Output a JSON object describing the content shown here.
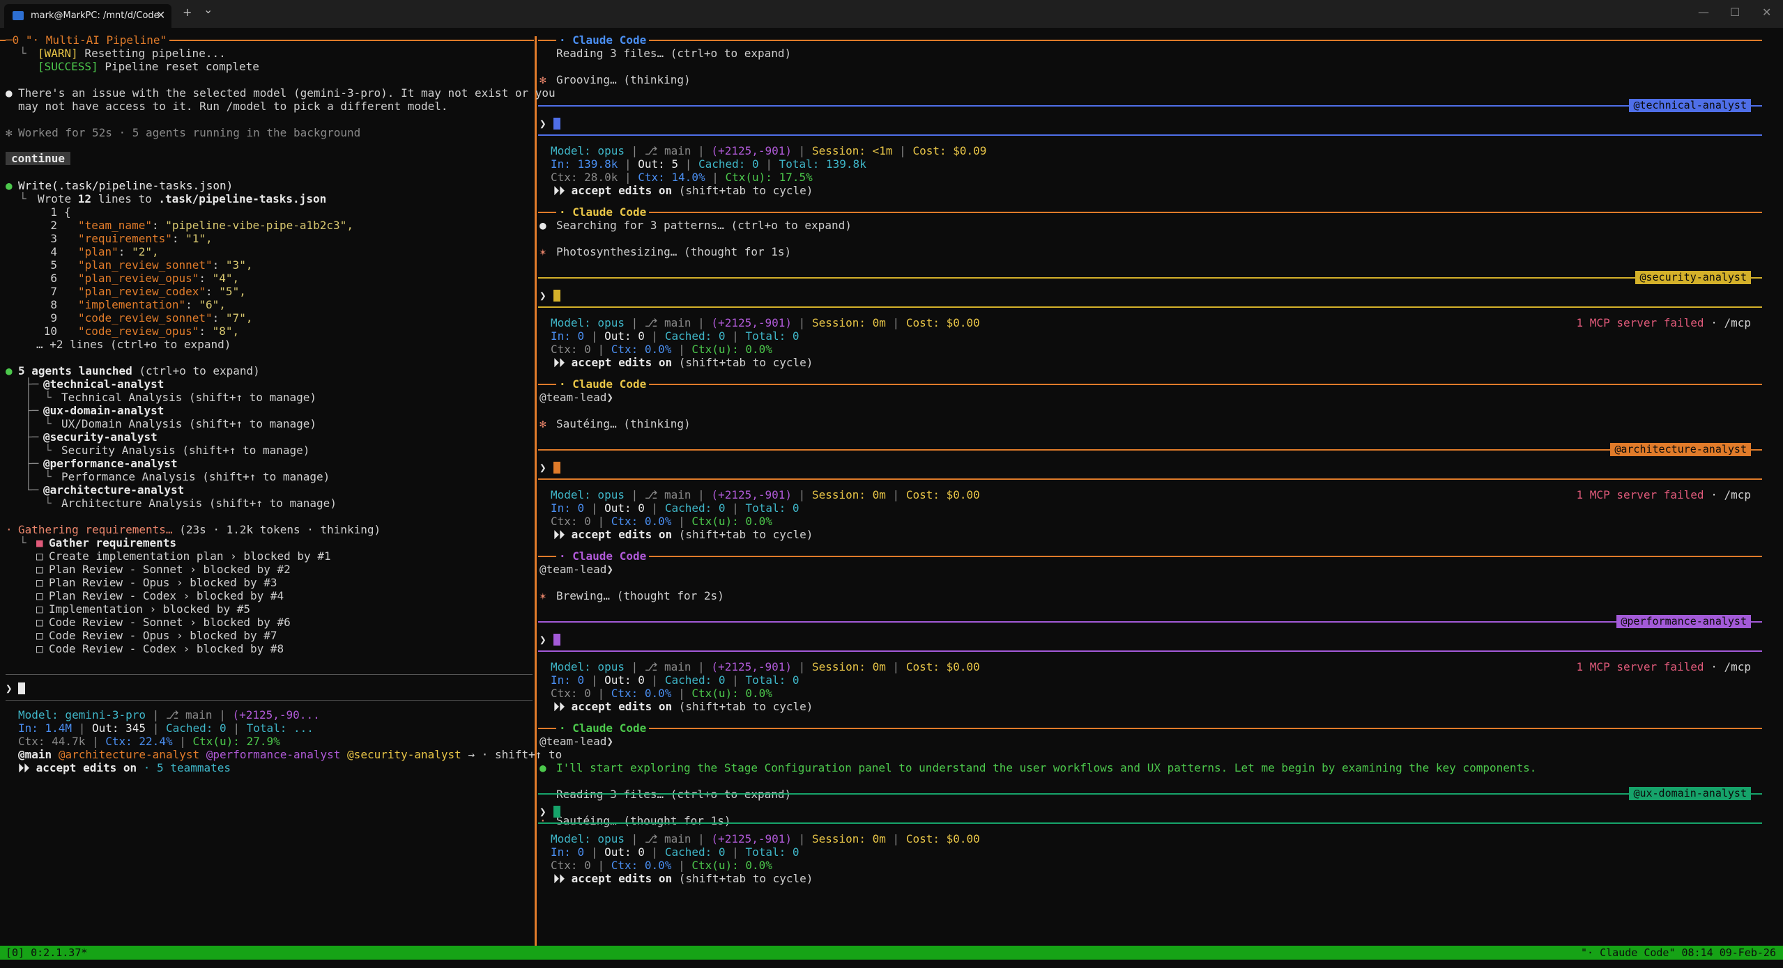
{
  "window": {
    "tab_title": "mark@MarkPC: /mnt/d/Code",
    "new_tab": "+",
    "dropdown": "⌄",
    "minimize": "—",
    "maximize": "☐",
    "close": "✕"
  },
  "left": {
    "header": "─0 \"· Multi-AI Pipeline\"",
    "warn_tag": "[WARN]",
    "warn_text": " Resetting pipeline...",
    "success_tag": "[SUCCESS]",
    "success_text": " Pipeline reset complete",
    "model_issue_1": "There's an issue with the selected model (gemini-3-pro). It may not exist or you",
    "model_issue_2": "may not have access to it. Run /model to pick a different model.",
    "worked": "Worked for 52s · 5 agents running in the background",
    "continue": "continue",
    "write_cmd": "Write(.task/pipeline-tasks.json)",
    "wrote_prefix": "Wrote ",
    "wrote_count": "12",
    "wrote_mid": " lines to ",
    "wrote_file": ".task/pipeline-tasks.json",
    "code_lines": [
      {
        "n": "1",
        "k": "",
        "v": "{"
      },
      {
        "n": "2",
        "k": "\"team_name\"",
        "v": "\"pipeline-vibe-pipe-a1b2c3\","
      },
      {
        "n": "3",
        "k": "\"requirements\"",
        "v": "\"1\","
      },
      {
        "n": "4",
        "k": "\"plan\"",
        "v": "\"2\","
      },
      {
        "n": "5",
        "k": "\"plan_review_sonnet\"",
        "v": "\"3\","
      },
      {
        "n": "6",
        "k": "\"plan_review_opus\"",
        "v": "\"4\","
      },
      {
        "n": "7",
        "k": "\"plan_review_codex\"",
        "v": "\"5\","
      },
      {
        "n": "8",
        "k": "\"implementation\"",
        "v": "\"6\","
      },
      {
        "n": "9",
        "k": "\"code_review_sonnet\"",
        "v": "\"7\","
      },
      {
        "n": "10",
        "k": "\"code_review_opus\"",
        "v": "\"8\","
      }
    ],
    "more_lines": "… +2 lines (ctrl+o to expand)",
    "agents_launched": "5 agents launched",
    "agents_expand": " (ctrl+o to expand)",
    "agents": [
      {
        "name": "@technical-analyst",
        "desc": "Technical Analysis (shift+↑ to manage)"
      },
      {
        "name": "@ux-domain-analyst",
        "desc": "UX/Domain Analysis (shift+↑ to manage)"
      },
      {
        "name": "@security-analyst",
        "desc": "Security Analysis (shift+↑ to manage)"
      },
      {
        "name": "@performance-analyst",
        "desc": "Performance Analysis (shift+↑ to manage)"
      },
      {
        "name": "@architecture-analyst",
        "desc": "Architecture Analysis (shift+↑ to manage)"
      }
    ],
    "gathering": "Gathering requirements…",
    "gathering_meta": " (23s · 1.2k tokens · thinking)",
    "tasks_head": "Gather requirements",
    "tasks": [
      "Create implementation plan › blocked by #1",
      "Plan Review - Sonnet › blocked by #2",
      "Plan Review - Opus › blocked by #3",
      "Plan Review - Codex › blocked by #4",
      "Implementation › blocked by #5",
      "Code Review - Sonnet › blocked by #6",
      "Code Review - Opus › blocked by #7",
      "Code Review - Codex › blocked by #8"
    ],
    "prompt": "❯",
    "status_model": "Model: gemini-3-pro",
    "status_branch": "⎇ main",
    "status_diff": "(+2125,-90...",
    "in": "In: 1.4M",
    "out": "Out: 345",
    "cached": "Cached: 0",
    "total": "Total: ...",
    "ctx": "Ctx: 44.7k",
    "ctxp": "Ctx: 22.4%",
    "ctxu": "Ctx(u): 27.9%",
    "team_main": "@main",
    "team_arch": "@architecture-analyst",
    "team_perf": "@performance-analyst",
    "team_sec": "@security-analyst",
    "team_tail": " → · shift+↑ to",
    "accept": "⏵⏵ accept edits on",
    "teammates": " · 5 teammates"
  },
  "panes": [
    {
      "title": "· Claude Code",
      "line1": "Reading 3 files… (ctrl+o to expand)",
      "line2": "Grooving… (thinking)",
      "tag": "@technical-analyst",
      "model": "Model: opus",
      "session": "Session: <1m",
      "cost": "Cost: $0.09",
      "in": "In: 139.8k",
      "out": "Out: 5",
      "cached": "Cached: 0",
      "total": "Total: 139.8k",
      "ctx": "Ctx: 28.0k",
      "ctxp": "Ctx: 14.0%",
      "ctxu": "Ctx(u): 17.5%",
      "mcp": ""
    },
    {
      "title": "· Claude Code",
      "line1": "Searching for 3 patterns… (ctrl+o to expand)",
      "line2": "Photosynthesizing… (thought for 1s)",
      "tag": "@security-analyst",
      "model": "Model: opus",
      "session": "Session: 0m",
      "cost": "Cost: $0.00",
      "in": "In: 0",
      "out": "Out: 0",
      "cached": "Cached: 0",
      "total": "Total: 0",
      "ctx": "Ctx: 0",
      "ctxp": "Ctx: 0.0%",
      "ctxu": "Ctx(u): 0.0%",
      "mcp": "1 MCP server failed"
    },
    {
      "title": "· Claude Code",
      "line1": "@team-lead❯",
      "line2": "Sautéing… (thinking)",
      "tag": "@architecture-analyst",
      "model": "Model: opus",
      "session": "Session: 0m",
      "cost": "Cost: $0.00",
      "in": "In: 0",
      "out": "Out: 0",
      "cached": "Cached: 0",
      "total": "Total: 0",
      "ctx": "Ctx: 0",
      "ctxp": "Ctx: 0.0%",
      "ctxu": "Ctx(u): 0.0%",
      "mcp": "1 MCP server failed"
    },
    {
      "title": "· Claude Code",
      "line1": "@team-lead❯",
      "line2": "Brewing… (thought for 2s)",
      "tag": "@performance-analyst",
      "model": "Model: opus",
      "session": "Session: 0m",
      "cost": "Cost: $0.00",
      "in": "In: 0",
      "out": "Out: 0",
      "cached": "Cached: 0",
      "total": "Total: 0",
      "ctx": "Ctx: 0",
      "ctxp": "Ctx: 0.0%",
      "ctxu": "Ctx(u): 0.0%",
      "mcp": "1 MCP server failed"
    },
    {
      "title": "· Claude Code",
      "line1": "@team-lead❯",
      "line2": "I'll start exploring the Stage Configuration panel to understand the user workflows and UX patterns. Let me begin by examining the key components.",
      "line3": "Reading 3 files… (ctrl+o to expand)",
      "line4": "Sautéing… (thought for 1s)",
      "tag": "@ux-domain-analyst",
      "model": "Model: opus",
      "session": "Session: 0m",
      "cost": "Cost: $0.00",
      "in": "In: 0",
      "out": "Out: 0",
      "cached": "Cached: 0",
      "total": "Total: 0",
      "ctx": "Ctx: 0",
      "ctxp": "Ctx: 0.0%",
      "ctxu": "Ctx(u): 0.0%",
      "mcp": ""
    }
  ],
  "common": {
    "branch": "⎇ main",
    "diff": "(+2125,-901)",
    "accept": "⏵⏵ accept edits on",
    "cycle": " (shift+tab to cycle)",
    "mcp_tail": " · /mcp",
    "prompt": "❯",
    "sep": "|"
  },
  "statusbar": {
    "left": "[0] 0:2.1.37*",
    "right": "\"· Claude Code\" 08:14 09-Feb-26"
  },
  "colors": {
    "orange": "#e07b2a",
    "blue": "#4f6fe8",
    "yellow": "#d4b12a",
    "purple": "#a35ad8",
    "green": "#16a36a",
    "status_green": "#16a316"
  }
}
